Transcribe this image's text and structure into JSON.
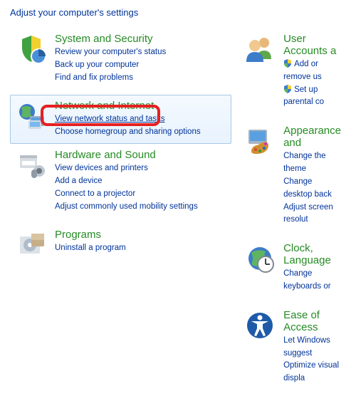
{
  "page_title": "Adjust your computer's settings",
  "left": [
    {
      "title": "System and Security",
      "links": [
        "Review your computer's status",
        "Back up your computer",
        "Find and fix problems"
      ],
      "emphasis": []
    },
    {
      "title": "Network and Internet",
      "links": [
        "View network status and tasks",
        "Choose homegroup and sharing options"
      ],
      "selected": true,
      "emphasis": [
        0
      ]
    },
    {
      "title": "Hardware and Sound",
      "links": [
        "View devices and printers",
        "Add a device",
        "Connect to a projector",
        "Adjust commonly used mobility settings"
      ],
      "emphasis": []
    },
    {
      "title": "Programs",
      "links": [
        "Uninstall a program"
      ],
      "emphasis": []
    }
  ],
  "right": [
    {
      "title": "User Accounts a",
      "links": [
        "Add or remove us",
        "Set up parental co"
      ],
      "shields": [
        0,
        1
      ]
    },
    {
      "title": "Appearance and",
      "links": [
        "Change the theme",
        "Change desktop back",
        "Adjust screen resolut"
      ]
    },
    {
      "title": "Clock, Language",
      "links": [
        "Change keyboards or"
      ]
    },
    {
      "title": "Ease of Access",
      "links": [
        "Let Windows suggest",
        "Optimize visual displa"
      ]
    }
  ]
}
